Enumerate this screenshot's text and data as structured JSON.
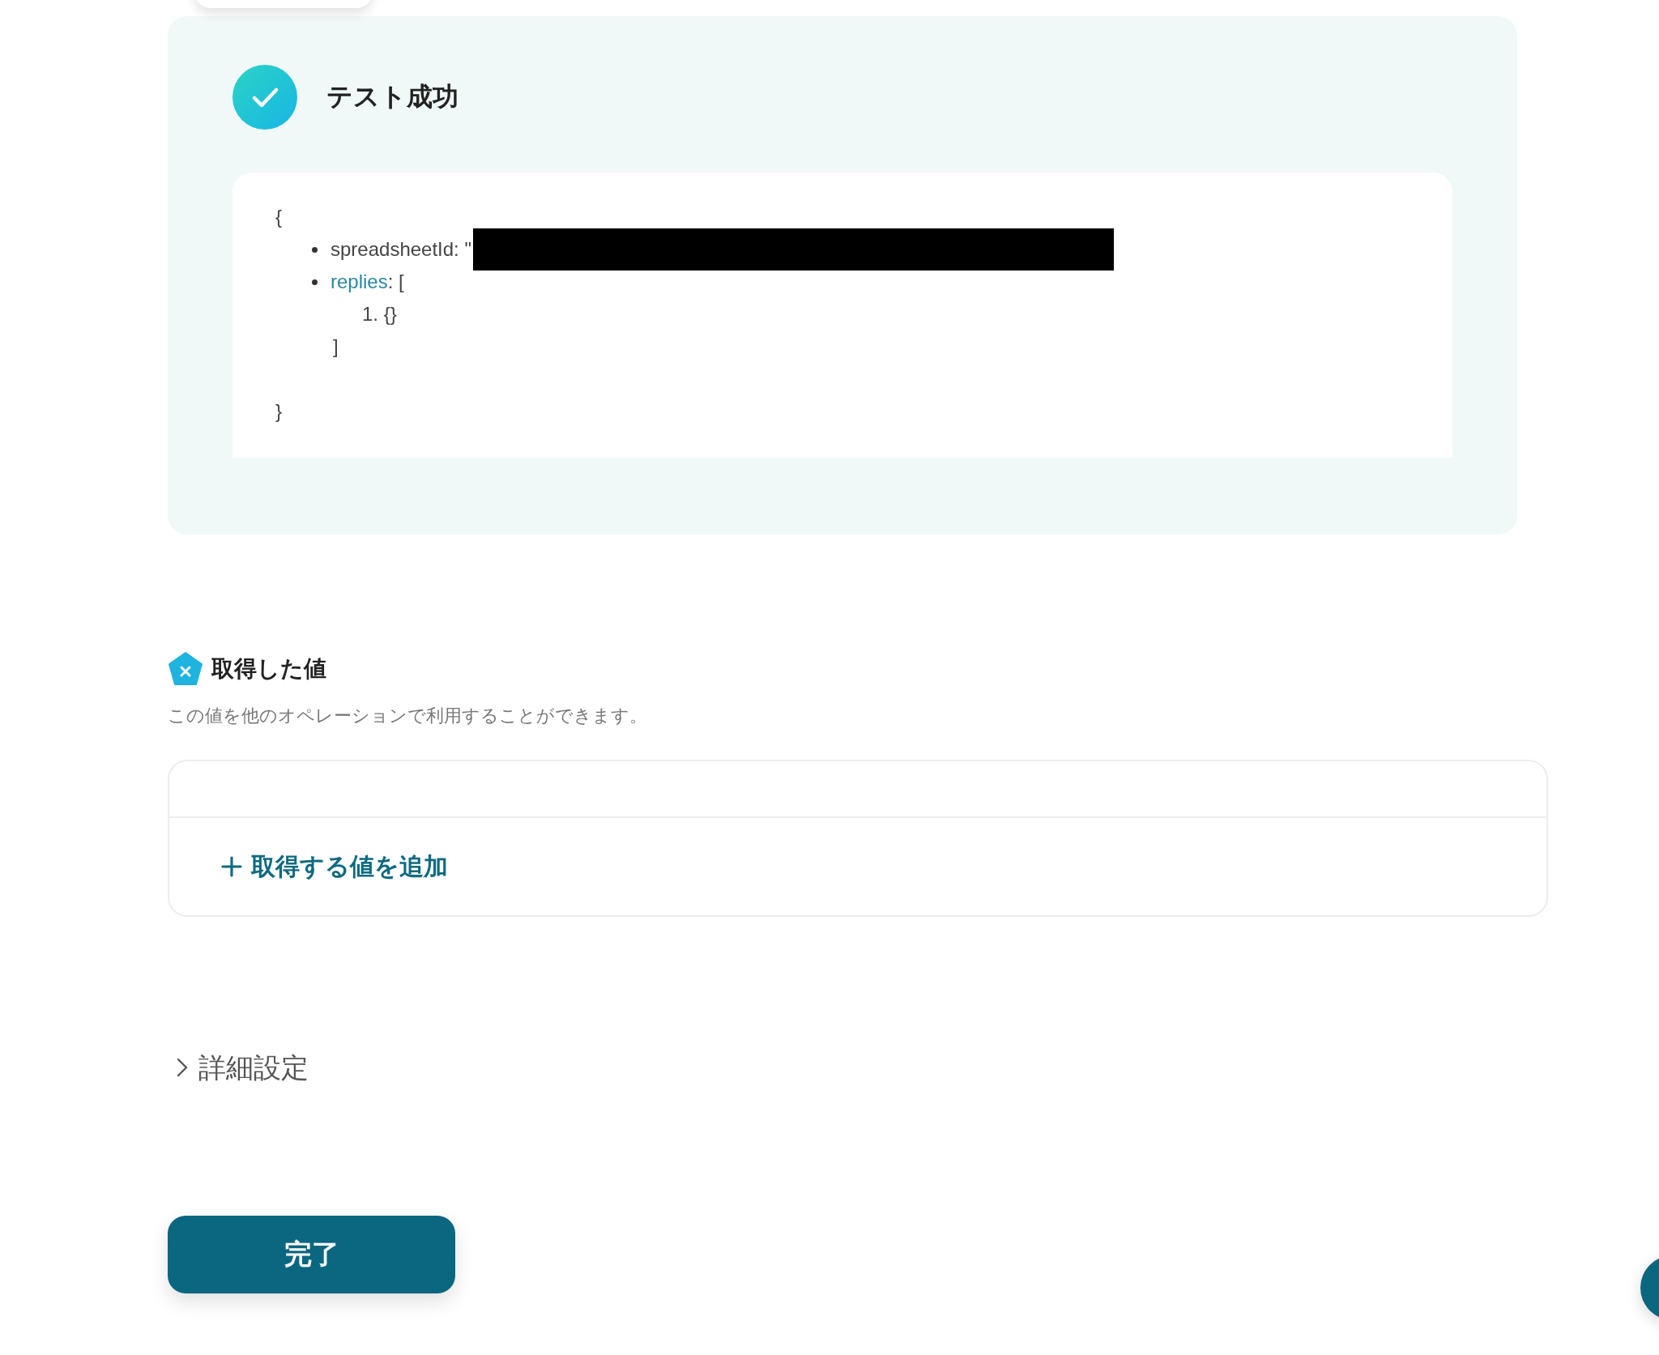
{
  "test_result": {
    "title": "テスト成功",
    "output": {
      "open_brace": "{",
      "fields": [
        {
          "key": "spreadsheetId",
          "kind": "redacted",
          "linked": false,
          "suffix": ": \""
        },
        {
          "key": "replies",
          "kind": "array",
          "linked": true,
          "suffix": ": [",
          "items": [
            {
              "marker": "1.",
              "value": "{}"
            }
          ],
          "close": "]"
        }
      ],
      "close_brace": "}"
    }
  },
  "values_section": {
    "title": "取得した値",
    "description": "この値を他のオペレーションで利用することができます。",
    "add_link": "取得する値を追加"
  },
  "advanced": {
    "label": "詳細設定",
    "expanded": false
  },
  "done_button": "完了"
}
